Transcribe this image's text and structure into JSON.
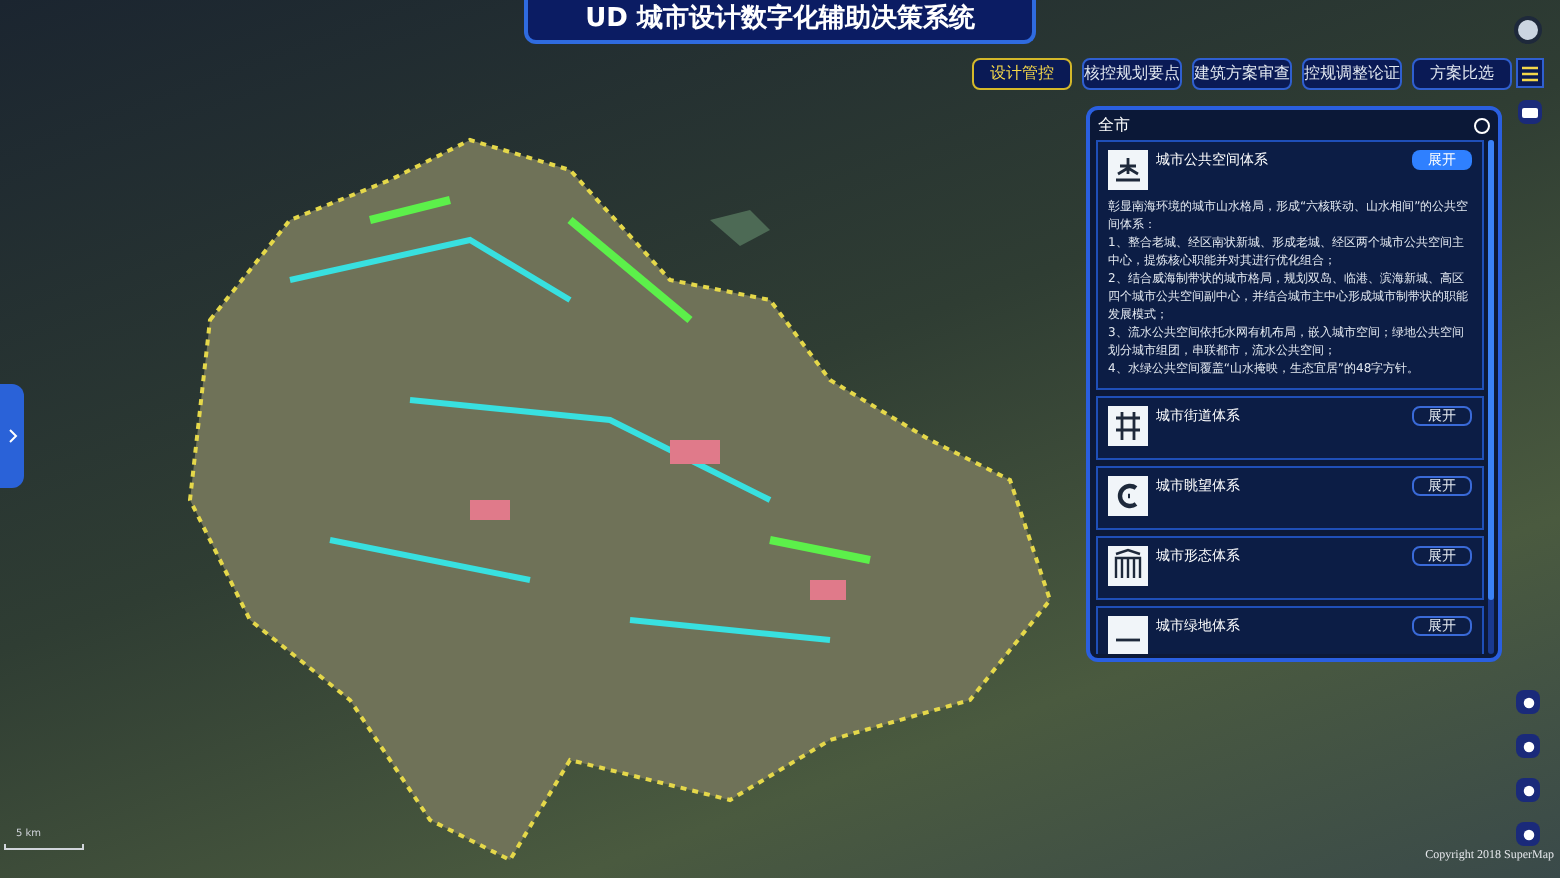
{
  "header": {
    "title": "UD 城市设计数字化辅助决策系统"
  },
  "nav": [
    {
      "label": "设计管控",
      "selected": true
    },
    {
      "label": "核控规划要点",
      "selected": false
    },
    {
      "label": "建筑方案审查",
      "selected": false
    },
    {
      "label": "控规调整论证",
      "selected": false
    },
    {
      "label": "方案比选",
      "selected": false
    }
  ],
  "panel": {
    "title": "全市",
    "cards": [
      {
        "title": "城市公共空间体系",
        "button": "展开",
        "expanded": true,
        "description": [
          "彰显南海环境的城市山水格局，形成“六核联动、山水相间”的公共空间体系：",
          "1、整合老城、经区南状新城、形成老城、经区两个城市公共空间主中心，提炼核心职能并对其进行优化组合；",
          "2、结合威海制带状的城市格局，规划双岛、临港、滨海新城、高区四个城市公共空间副中心，并结合城市主中心形成城市制带状的职能发展模式；",
          "3、流水公共空间依托水网有机布局，嵌入城市空间；绿地公共空间划分城市组团，串联都市，流水公共空间；",
          "4、水绿公共空间覆盖“山水掩映，生态宜居”的48字方针。"
        ]
      },
      {
        "title": "城市街道体系",
        "button": "展开",
        "expanded": false
      },
      {
        "title": "城市眺望体系",
        "button": "展开",
        "expanded": false
      },
      {
        "title": "城市形态体系",
        "button": "展开",
        "expanded": false
      },
      {
        "title": "城市绿地体系",
        "button": "展开",
        "expanded": false
      }
    ]
  },
  "map": {
    "scale": "5 km",
    "copyright": "Copyright 2018 SuperMap"
  }
}
